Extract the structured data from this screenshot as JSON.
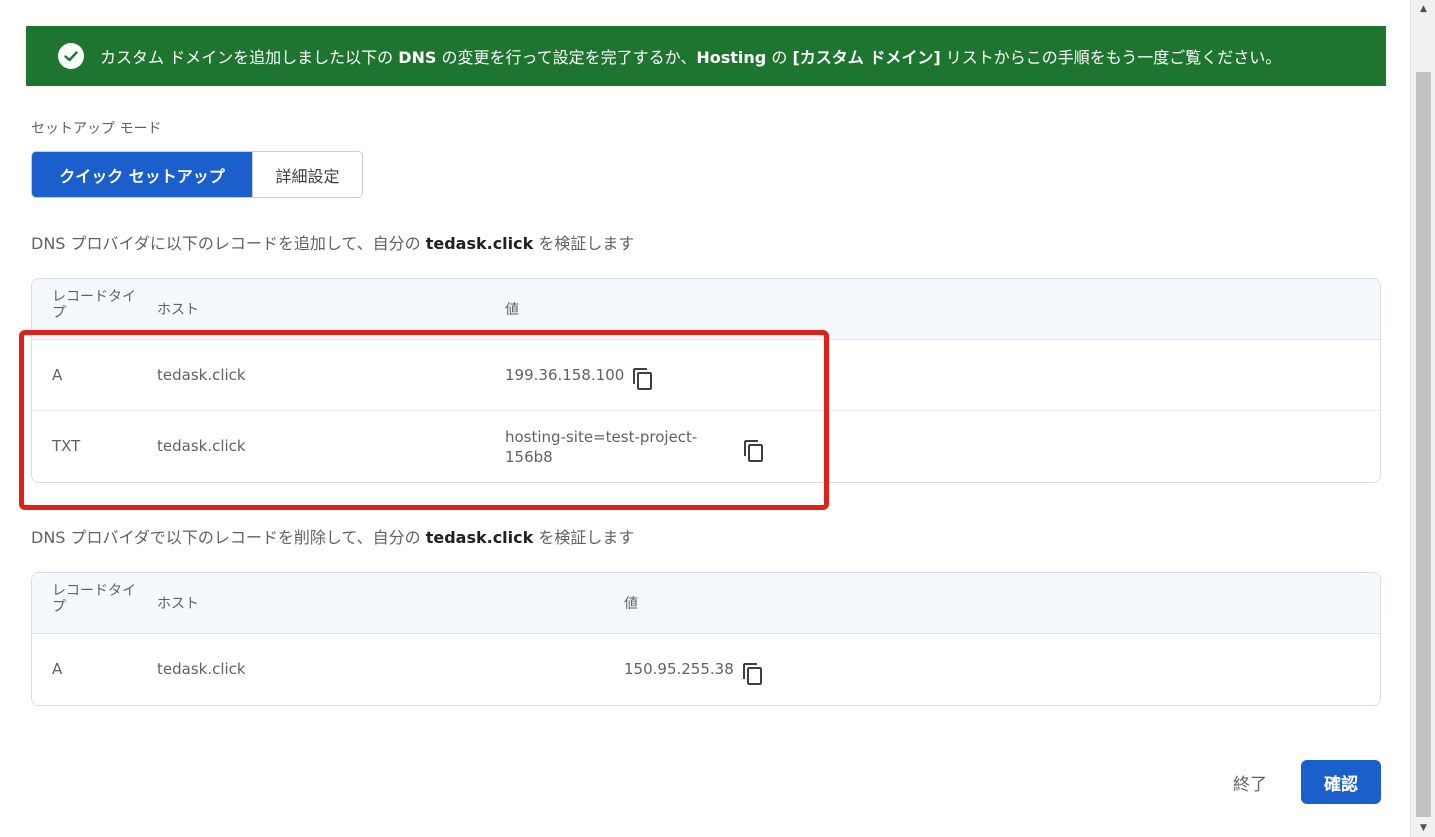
{
  "banner": {
    "text_1": "カスタム ドメインを追加しました以下の ",
    "text_2": "DNS",
    "text_3": " の変更を行って設定を完了するか、",
    "text_4": "Hosting",
    "text_5": " の ",
    "text_6": "[カスタム ドメイン]",
    "text_7": " リストからこの手順をもう一度ご覧ください。",
    "color": "#1e7530"
  },
  "setup_mode": {
    "label": "セットアップ モード",
    "options": [
      "クイック セットアップ",
      "詳細設定"
    ],
    "selected": "クイック セットアップ"
  },
  "add_section": {
    "instruction_pre": "DNS プロバイダに以下のレコードを追加して、自分の ",
    "domain": "tedask.click",
    "instruction_post": " を検証します",
    "headers": {
      "type": "レコードタイプ",
      "host": "ホスト",
      "value": "値"
    },
    "rows": [
      {
        "type": "A",
        "host": "tedask.click",
        "value": "199.36.158.100"
      },
      {
        "type": "TXT",
        "host": "tedask.click",
        "value_line1": "hosting-site=test-project-",
        "value_line2": "156b8"
      }
    ]
  },
  "remove_section": {
    "instruction_pre": "DNS プロバイダで以下のレコードを削除して、自分の ",
    "domain": "tedask.click",
    "instruction_post": " を検証します",
    "headers": {
      "type": "レコードタイプ",
      "host": "ホスト",
      "value": "値"
    },
    "rows": [
      {
        "type": "A",
        "host": "tedask.click",
        "value": "150.95.255.38"
      }
    ]
  },
  "footer": {
    "end_label": "終了",
    "confirm_label": "確認"
  },
  "colors": {
    "primary": "#1a5fcc",
    "highlight": "#e0201b"
  }
}
